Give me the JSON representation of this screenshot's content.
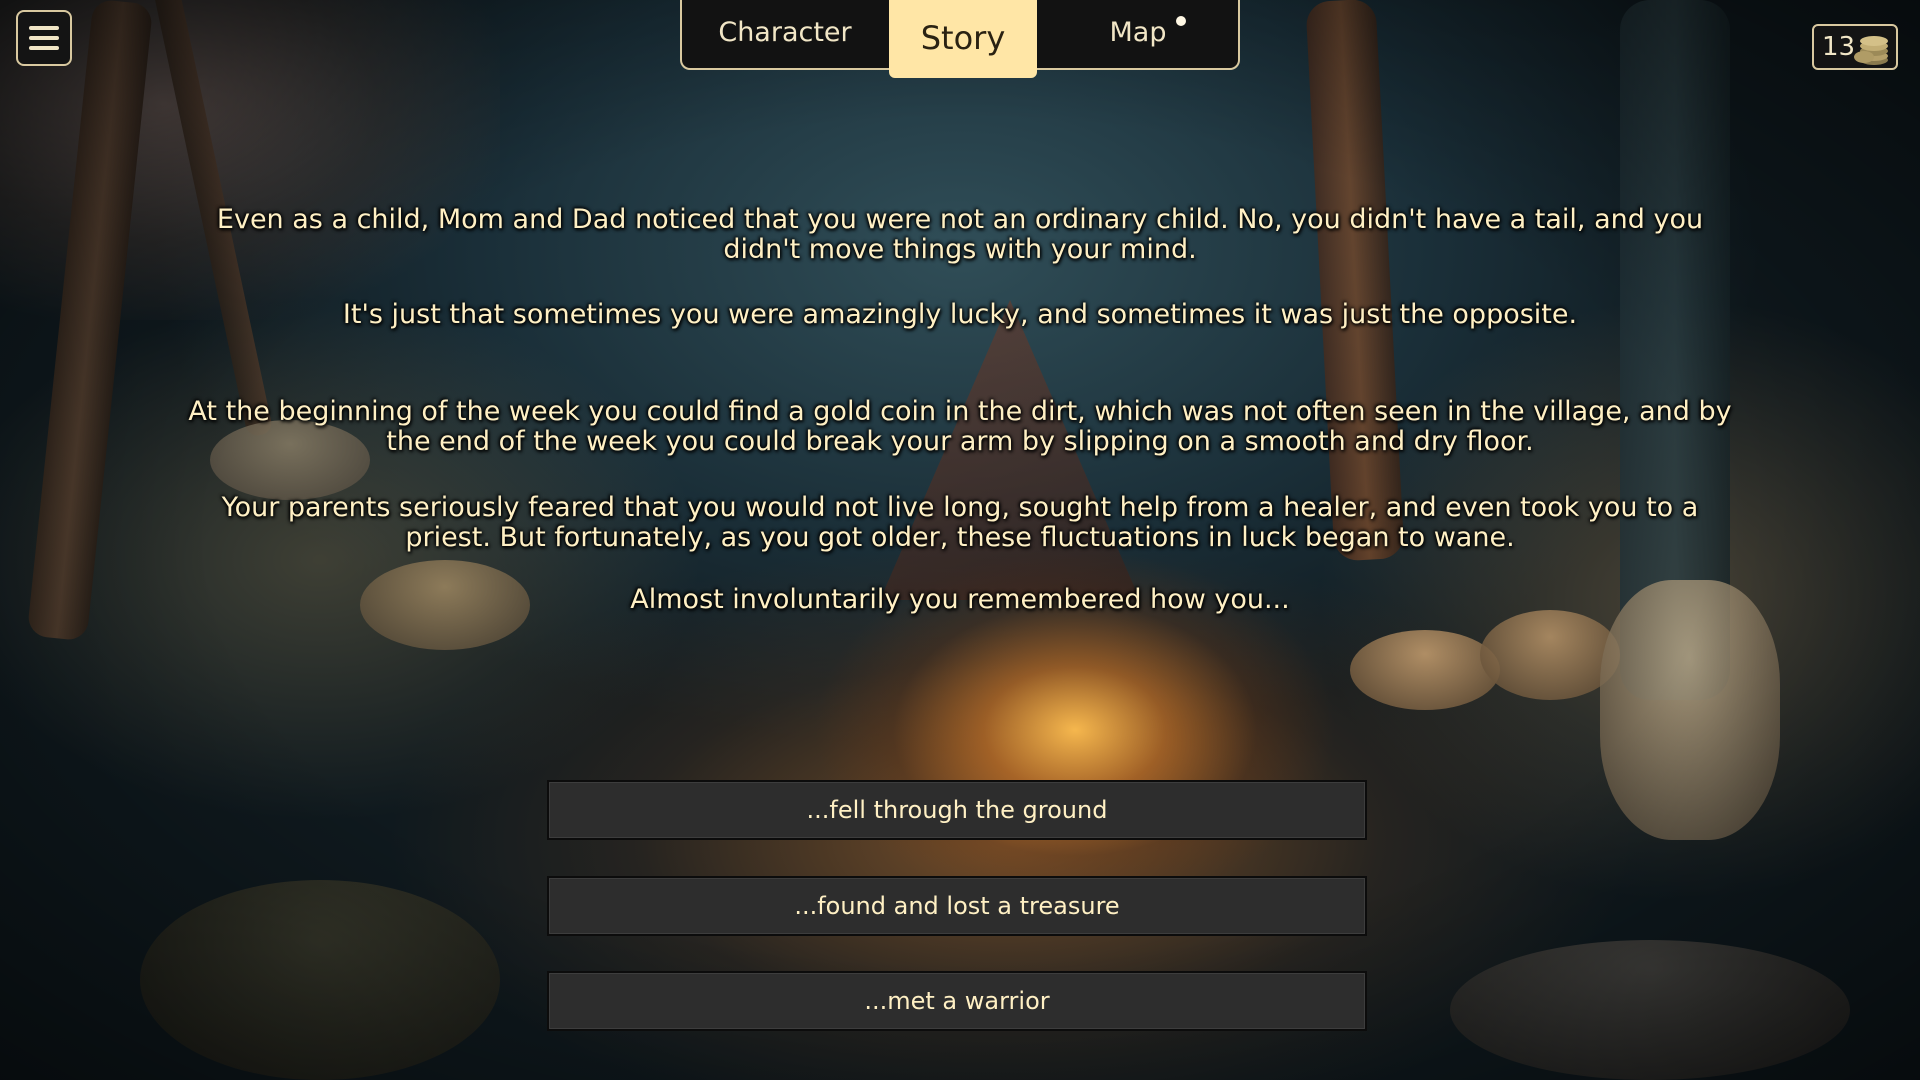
{
  "header": {
    "menu_icon": "hamburger-menu-icon",
    "tabs": [
      {
        "label": "Character",
        "active": false
      },
      {
        "label": "Story",
        "active": true
      },
      {
        "label": "Map",
        "active": false,
        "notification": true
      }
    ],
    "coins": {
      "count": "13",
      "icon": "coin-stack-icon"
    }
  },
  "story": {
    "paragraphs": [
      "Even as a child, Mom and Dad noticed that you were not an ordinary child. No, you didn't have a tail, and you didn't move things with your mind.",
      "It's just that sometimes you were amazingly lucky, and sometimes it was just the opposite.",
      "At the beginning of the week you could find a gold coin in the dirt, which was not often seen in the village, and by the end of the week you could break your arm by slipping on a smooth and dry floor.",
      "Your parents seriously feared that you would not live long, sought help from a healer, and even took you to a priest. But fortunately, as you got older, these fluctuations in luck began to wane.",
      "Almost involuntarily you remembered how you..."
    ]
  },
  "choices": [
    {
      "label": "...fell through the ground"
    },
    {
      "label": "...found and lost a treasure"
    },
    {
      "label": "...met a warrior"
    }
  ],
  "colors": {
    "accent_tab": "#ffe6a6",
    "panel_bg": "#121212",
    "panel_border": "#d9c9a0",
    "text": "#fff0c4",
    "choice_bg": "#2d2d2d"
  }
}
